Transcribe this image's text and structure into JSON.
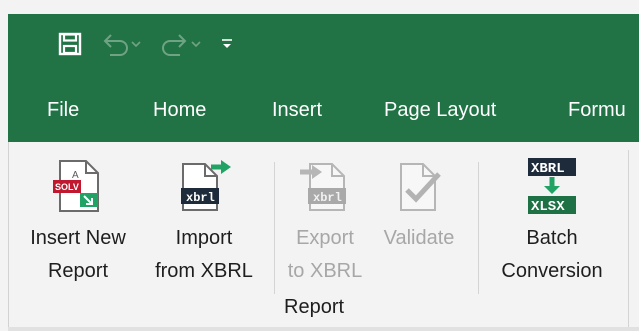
{
  "quick_access": {
    "save_icon": "save-icon",
    "undo_icon": "undo-icon",
    "redo_icon": "redo-icon",
    "customize_icon": "customize-qat-icon"
  },
  "menu_tabs": [
    "File",
    "Home",
    "Insert",
    "Page Layout",
    "Formu"
  ],
  "ribbon": {
    "buttons": [
      {
        "line1": "Insert New",
        "line2": "Report",
        "icon": "insert-new-report-icon",
        "enabled": true
      },
      {
        "line1": "Import",
        "line2": "from XBRL",
        "icon": "import-xbrl-icon",
        "enabled": true
      },
      {
        "line1": "Export",
        "line2": "to XBRL",
        "icon": "export-xbrl-icon",
        "enabled": false
      },
      {
        "line1": "Validate",
        "line2": "",
        "icon": "validate-icon",
        "enabled": false
      },
      {
        "line1": "Batch",
        "line2": "Conversion",
        "icon": "batch-conversion-icon",
        "enabled": true
      }
    ],
    "group_label": "Report",
    "icon_text": {
      "solv": "SOLV",
      "xbrl": "xbrl",
      "xbrl_upper": "XBRL",
      "xlsx": "XLSX"
    }
  },
  "colors": {
    "titlebar": "#217346",
    "ribbon_bg": "#f3f3f3",
    "text": "#1e1e1e",
    "disabled_text": "#a7a7a7",
    "accent_green": "#21a366"
  }
}
